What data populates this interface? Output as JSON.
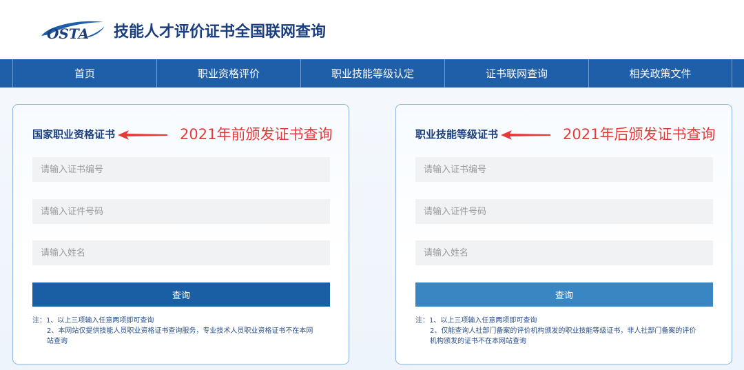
{
  "header": {
    "logo_text": "OSTA",
    "title": "技能人才评价证书全国联网查询"
  },
  "nav": {
    "items": [
      {
        "label": "首页"
      },
      {
        "label": "职业资格评价"
      },
      {
        "label": "职业技能等级认定"
      },
      {
        "label": "证书联网查询"
      },
      {
        "label": "相关政策文件"
      }
    ]
  },
  "left_card": {
    "title": "国家职业资格证书",
    "annotation": "2021年前颁发证书查询",
    "cert_no_placeholder": "请输入证书编号",
    "id_no_placeholder": "请输入证件号码",
    "name_placeholder": "请输入姓名",
    "button_label": "查询",
    "note_1": "注：1、以上三项输入任意两项即可查询",
    "note_2a": "2、本网站仅提供技能人员职业资格证书查询服务，专业技术人员职业资格证书不在本网",
    "note_2b": "站查询"
  },
  "right_card": {
    "title": "职业技能等级证书",
    "annotation": "2021年后颁发证书查询",
    "cert_no_placeholder": "请输入证书编号",
    "id_no_placeholder": "请输入证件号码",
    "name_placeholder": "请输入姓名",
    "button_label": "查询",
    "note_1": "注：1、以上三项输入任意两项即可查询",
    "note_2a": "2、仅能查询人社部门备案的评价机构颁发的职业技能等级证书，非人社部门备案的评价",
    "note_2b": "机构颁发的证书不在本网站查询"
  },
  "colors": {
    "nav_bg": "#1f5ea8",
    "title_blue": "#1b3f7e",
    "annotation_red": "#e63a3a",
    "button_dark": "#1a5fa3",
    "button_light": "#3a86c2"
  }
}
